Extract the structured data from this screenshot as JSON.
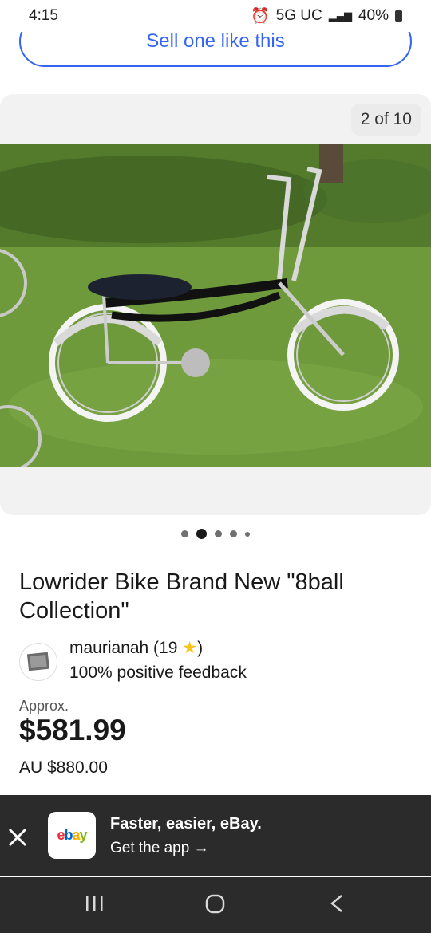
{
  "status": {
    "time": "4:15",
    "network": "5G UC",
    "battery": "40%"
  },
  "sell_button": "Sell one like this",
  "gallery": {
    "counter": "2 of 10",
    "dots_total": 5,
    "active_dot": 1
  },
  "listing": {
    "title": "Lowrider Bike Brand New \"8ball Collection\"",
    "seller_name": "maurianah (19",
    "seller_close": ")",
    "seller_feedback": "100% positive feedback",
    "approx_label": "Approx.",
    "price": "$581.99",
    "price_alt": "AU $880.00"
  },
  "app_banner": {
    "logo_text": [
      "e",
      "b",
      "a",
      "y"
    ],
    "title": "Faster, easier, eBay.",
    "cta": "Get the app →"
  },
  "colors": {
    "accent": "#3665f3",
    "banner_bg": "#2b2b2b",
    "star": "#f5c518"
  }
}
